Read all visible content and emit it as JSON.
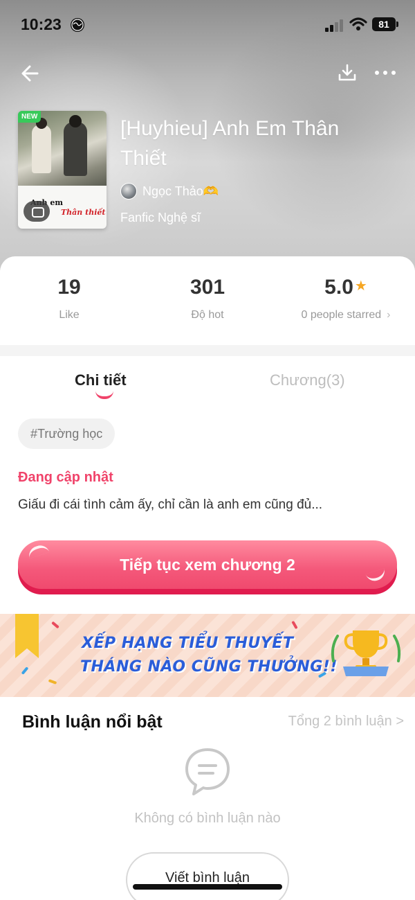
{
  "status_bar": {
    "time": "10:23",
    "battery": "81"
  },
  "book": {
    "title": "[Huyhieu] Anh Em Thân Thiết",
    "author": "Ngọc Thảo🫶",
    "genre": "Fanfic Nghệ sĩ",
    "cover": {
      "badge": "NEW",
      "line1": "Anh em",
      "line2": "Thân thiết"
    }
  },
  "stats": {
    "likes": {
      "value": "19",
      "label": "Like"
    },
    "hot": {
      "value": "301",
      "label": "Độ hot"
    },
    "rating": {
      "value": "5.0",
      "label": "0 people starred"
    }
  },
  "tabs": {
    "details": "Chi tiết",
    "chapters": "Chương(3)"
  },
  "details": {
    "tag": "#Trường học",
    "status": "Đang cập nhật",
    "description": "Giấu đi cái tình cảm ấy, chỉ cần là anh em cũng đủ...",
    "cta": "Tiếp tục xem chương 2"
  },
  "banner": {
    "line1": "XẾP HẠNG TIỂU THUYẾT",
    "line2": "THÁNG NÀO CŨNG THƯỞNG!!"
  },
  "comments": {
    "title": "Bình luận nổi bật",
    "total": "Tổng 2 bình luận >",
    "empty": "Không có bình luận nào",
    "write": "Viết bình luận"
  },
  "colors": {
    "accent": "#f0436a",
    "star": "#f6a623",
    "banner_text": "#2a5dd9"
  },
  "icons": [
    "back-arrow-icon",
    "download-icon",
    "more-icon",
    "star-icon",
    "chat-bubble-icon",
    "trophy-icon",
    "bookmark-icon"
  ]
}
